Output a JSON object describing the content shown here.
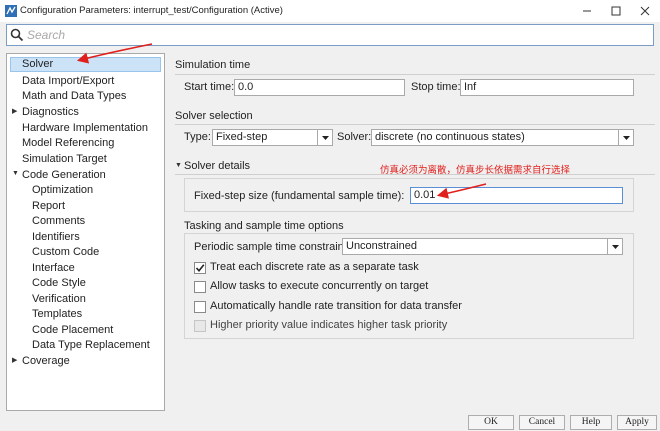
{
  "window": {
    "title": "Configuration Parameters: interrupt_test/Configuration (Active)"
  },
  "search": {
    "placeholder": "Search"
  },
  "tree": {
    "items": [
      {
        "label": "Solver",
        "level": 0,
        "expander": ""
      },
      {
        "label": "Data Import/Export",
        "level": 0,
        "expander": ""
      },
      {
        "label": "Math and Data Types",
        "level": 0,
        "expander": ""
      },
      {
        "label": "Diagnostics",
        "level": 0,
        "expander": "collapsed"
      },
      {
        "label": "Hardware Implementation",
        "level": 0,
        "expander": ""
      },
      {
        "label": "Model Referencing",
        "level": 0,
        "expander": ""
      },
      {
        "label": "Simulation Target",
        "level": 0,
        "expander": ""
      },
      {
        "label": "Code Generation",
        "level": 0,
        "expander": "expanded"
      },
      {
        "label": "Optimization",
        "level": 1,
        "expander": ""
      },
      {
        "label": "Report",
        "level": 1,
        "expander": ""
      },
      {
        "label": "Comments",
        "level": 1,
        "expander": ""
      },
      {
        "label": "Identifiers",
        "level": 1,
        "expander": ""
      },
      {
        "label": "Custom Code",
        "level": 1,
        "expander": ""
      },
      {
        "label": "Interface",
        "level": 1,
        "expander": ""
      },
      {
        "label": "Code Style",
        "level": 1,
        "expander": ""
      },
      {
        "label": "Verification",
        "level": 1,
        "expander": ""
      },
      {
        "label": "Templates",
        "level": 1,
        "expander": ""
      },
      {
        "label": "Code Placement",
        "level": 1,
        "expander": ""
      },
      {
        "label": "Data Type Replacement",
        "level": 1,
        "expander": ""
      },
      {
        "label": "Coverage",
        "level": 0,
        "expander": "collapsed"
      }
    ]
  },
  "simulation_time": {
    "title": "Simulation time",
    "start_label": "Start time:",
    "start_value": "0.0",
    "stop_label": "Stop time:",
    "stop_value": "Inf"
  },
  "solver_selection": {
    "title": "Solver selection",
    "type_label": "Type:",
    "type_value": "Fixed-step",
    "solver_label": "Solver:",
    "solver_value": "discrete (no continuous states)"
  },
  "solver_details": {
    "title": "Solver details",
    "step_label": "Fixed-step size (fundamental sample time):",
    "step_value": "0.01"
  },
  "tasking": {
    "title": "Tasking and sample time options",
    "constraint_label": "Periodic sample time constraint:",
    "constraint_value": "Unconstrained",
    "options": [
      {
        "label": "Treat each discrete rate as a separate task",
        "checked": true,
        "enabled": true
      },
      {
        "label": "Allow tasks to execute concurrently on target",
        "checked": false,
        "enabled": true
      },
      {
        "label": "Automatically handle rate transition for data transfer",
        "checked": false,
        "enabled": true
      },
      {
        "label": "Higher priority value indicates higher task priority",
        "checked": false,
        "enabled": false
      }
    ]
  },
  "annotation": {
    "text": "仿真必须为离散，仿真步长依据需求自行选择",
    "color": "#e0201c"
  },
  "buttons": {
    "ok": "OK",
    "cancel": "Cancel",
    "help": "Help",
    "apply": "Apply"
  },
  "colors": {
    "accent": "#cbe2f7",
    "annotation": "#e0201c"
  }
}
